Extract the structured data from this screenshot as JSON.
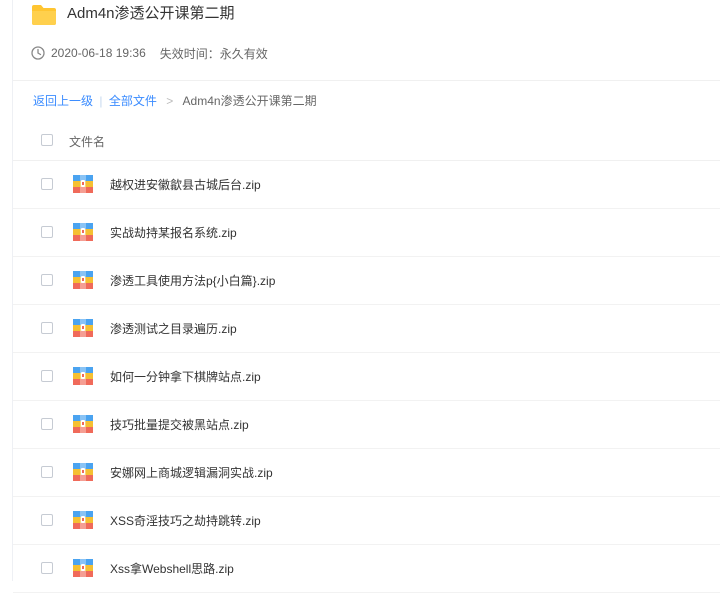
{
  "share": {
    "title": "Adm4n渗透公开课第二期",
    "date": "2020-06-18 19:36",
    "expire": "失效时间：永久有效"
  },
  "breadcrumb": {
    "back": "返回上一级",
    "separator": "|",
    "all_files": "全部文件",
    "arrow": ">",
    "current": "Adm4n渗透公开课第二期"
  },
  "table": {
    "header": "文件名",
    "files": [
      "越权进安徽歙县古城后台.zip",
      "实战劫持某报名系统.zip",
      "渗透工具使用方法p{小白篇}.zip",
      "渗透测试之目录遍历.zip",
      "如何一分钟拿下棋牌站点.zip",
      "技巧批量提交被黑站点.zip",
      "安娜网上商城逻辑漏洞实战.zip",
      "XSS奇淫技巧之劫持跳转.zip",
      "Xss拿Webshell思路.zip"
    ]
  },
  "icons": {
    "folder": "folder-icon",
    "clock": "clock-icon",
    "file": "zip-archive-icon"
  },
  "colors": {
    "link": "#3b8cff",
    "folder": "#ffc531"
  }
}
